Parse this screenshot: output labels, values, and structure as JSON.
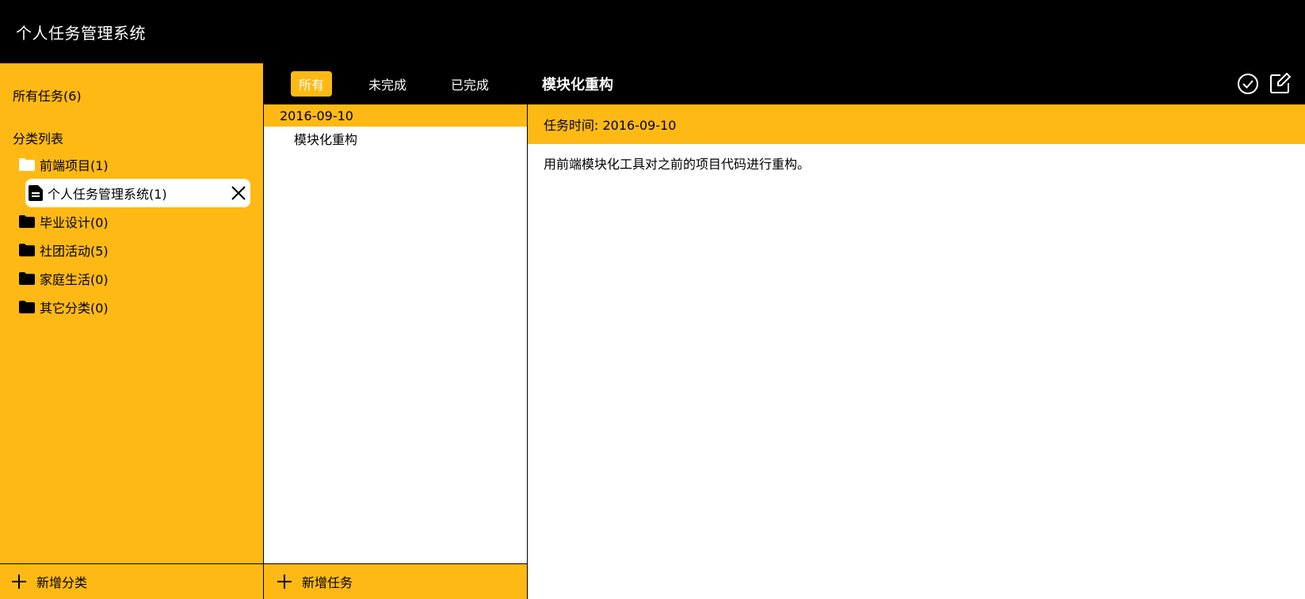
{
  "app": {
    "title": "个人任务管理系统"
  },
  "sidebar": {
    "all_tasks": "所有任务(6)",
    "category_heading": "分类列表",
    "categories": [
      {
        "label": "前端项目(1)",
        "icon": "folder-open-icon"
      },
      {
        "label": "毕业设计(0)",
        "icon": "folder-icon"
      },
      {
        "label": "社团活动(5)",
        "icon": "folder-icon"
      },
      {
        "label": "家庭生活(0)",
        "icon": "folder-icon"
      },
      {
        "label": "其它分类(0)",
        "icon": "folder-icon"
      }
    ],
    "selected_subcategory": {
      "label": "个人任务管理系统(1)",
      "icon": "document-icon"
    },
    "add_category": "新增分类"
  },
  "task_list": {
    "filters": [
      {
        "label": "所有",
        "active": true
      },
      {
        "label": "未完成",
        "active": false
      },
      {
        "label": "已完成",
        "active": false
      }
    ],
    "groups": [
      {
        "date": "2016-09-10",
        "tasks": [
          "模块化重构"
        ]
      }
    ],
    "add_task": "新增任务"
  },
  "detail": {
    "title": "模块化重构",
    "time_label": "任务时间: 2016-09-10",
    "content": "用前端模块化工具对之前的项目代码进行重构。"
  },
  "colors": {
    "accent": "#FFB914",
    "dark": "#000000",
    "light": "#FFFFFF"
  }
}
